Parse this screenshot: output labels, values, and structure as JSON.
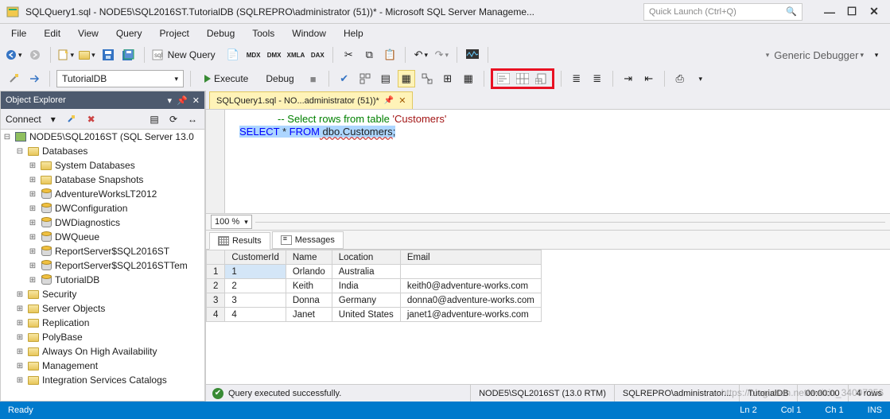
{
  "titlebar": {
    "title": "SQLQuery1.sql - NODE5\\SQL2016ST.TutorialDB (SQLREPRO\\administrator (51))* - Microsoft SQL Server Manageme...",
    "quick_launch_placeholder": "Quick Launch (Ctrl+Q)"
  },
  "menu": [
    "File",
    "Edit",
    "View",
    "Query",
    "Project",
    "Debug",
    "Tools",
    "Window",
    "Help"
  ],
  "toolbar1": {
    "new_query": "New Query",
    "debugger": "Generic Debugger"
  },
  "toolbar2": {
    "db_selected": "TutorialDB",
    "execute": "Execute",
    "debug": "Debug"
  },
  "object_explorer": {
    "title": "Object Explorer",
    "connect": "Connect",
    "root": "NODE5\\SQL2016ST (SQL Server 13.0",
    "databases": "Databases",
    "sysdb": "System Databases",
    "snap": "Database Snapshots",
    "children": [
      "AdventureWorksLT2012",
      "DWConfiguration",
      "DWDiagnostics",
      "DWQueue",
      "ReportServer$SQL2016ST",
      "ReportServer$SQL2016STTem",
      "TutorialDB"
    ],
    "folders": [
      "Security",
      "Server Objects",
      "Replication",
      "PolyBase",
      "Always On High Availability",
      "Management",
      "Integration Services Catalogs"
    ]
  },
  "doc_tab": "SQLQuery1.sql - NO...administrator (51))*",
  "editor": {
    "line1_a": "-- Select rows from table ",
    "line1_b": "'Customers'",
    "line2_a": "SELECT",
    "line2_b": " * ",
    "line2_c": "FROM",
    "line2_d": " dbo.Customers",
    "line2_e": ";"
  },
  "zoom": "100 %",
  "results": {
    "tab_results": "Results",
    "tab_messages": "Messages",
    "headers": [
      "CustomerId",
      "Name",
      "Location",
      "Email"
    ],
    "rows": [
      {
        "n": "1",
        "id": "1",
        "name": "Orlando",
        "loc": "Australia",
        "email": ""
      },
      {
        "n": "2",
        "id": "2",
        "name": "Keith",
        "loc": "India",
        "email": "keith0@adventure-works.com"
      },
      {
        "n": "3",
        "id": "3",
        "name": "Donna",
        "loc": "Germany",
        "email": "donna0@adventure-works.com"
      },
      {
        "n": "4",
        "id": "4",
        "name": "Janet",
        "loc": "United States",
        "email": "janet1@adventure-works.com"
      }
    ]
  },
  "query_status": {
    "msg": "Query executed successfully.",
    "server": "NODE5\\SQL2016ST (13.0 RTM)",
    "user": "SQLREPRO\\administrator...",
    "db": "TutorialDB",
    "time": "00:00:00",
    "rows": "4 rows"
  },
  "statusbar": {
    "ready": "Ready",
    "ln": "Ln 2",
    "col": "Col 1",
    "ch": "Ch 1",
    "ins": "INS"
  },
  "watermark": "https://blog.csdn.net/weixin_34007256"
}
